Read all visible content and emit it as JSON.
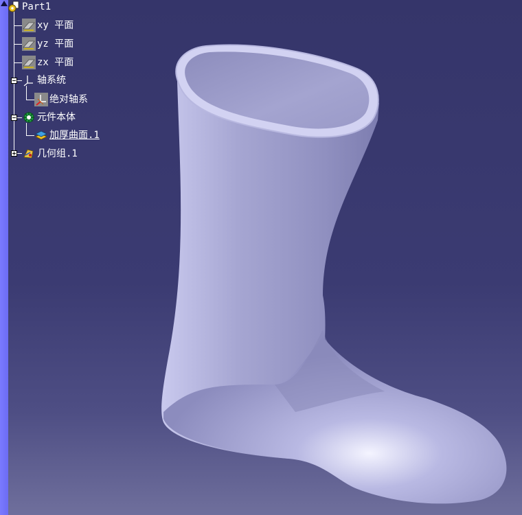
{
  "tree": {
    "root": {
      "label": "Part1",
      "icon": "part-gear-icon"
    },
    "items": [
      {
        "label": "xy 平面",
        "icon": "plane-icon"
      },
      {
        "label": "yz 平面",
        "icon": "plane-icon"
      },
      {
        "label": "zx 平面",
        "icon": "plane-icon"
      },
      {
        "label": "轴系统",
        "icon": "axis-system-icon"
      },
      {
        "label": "绝对轴系",
        "icon": "absolute-axis-icon"
      },
      {
        "label": "元件本体",
        "icon": "part-body-icon"
      },
      {
        "label": "加厚曲面.1",
        "icon": "thick-surface-icon"
      },
      {
        "label": "几何组.1",
        "icon": "geometric-set-icon"
      }
    ]
  },
  "colors": {
    "background_top": "#35356a",
    "background_bottom": "#6f6f9c",
    "tree_text": "#ffffff",
    "model": "#a9a9d6",
    "left_bar": "#7a7aff"
  }
}
